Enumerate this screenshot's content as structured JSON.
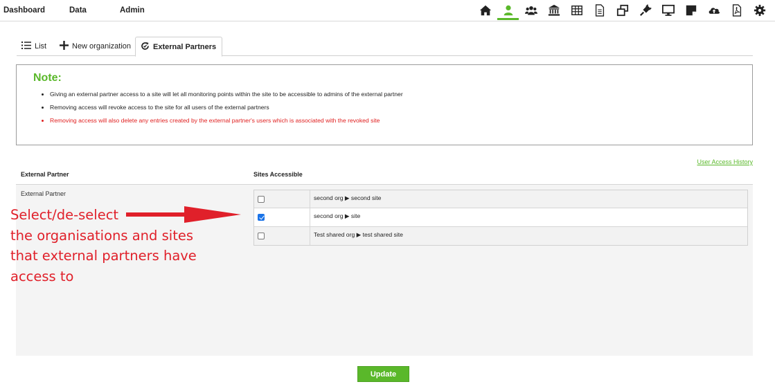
{
  "nav": {
    "menus": [
      "Dashboard",
      "Data",
      "Admin"
    ],
    "icons": [
      "home-icon",
      "user-icon",
      "users-icon",
      "bank-icon",
      "table-icon",
      "document-icon",
      "windows-icon",
      "plug-icon",
      "monitor-icon",
      "note-icon",
      "cloud-upload-icon",
      "pdf-icon",
      "gear-icon"
    ],
    "active_icon": "user-icon"
  },
  "tabs": [
    {
      "label": "List",
      "icon": "list-icon"
    },
    {
      "label": "New organization",
      "icon": "plus-icon"
    },
    {
      "label": "External Partners",
      "icon": "refresh-icon",
      "active": true
    }
  ],
  "note": {
    "title": "Note:",
    "items": [
      "Giving an external partner access to a site will let all monitoring points within the site to be accessible to admins of the external partner",
      "Removing access will revoke access to the site for all users of the external partners",
      "Removing access will also delete any entries created by the external partner's users which is associated with the revoked site"
    ]
  },
  "history_link": "User Access History",
  "table": {
    "headers": [
      "External Partner",
      "Sites Accessible"
    ],
    "partner": "External Partner",
    "sites": [
      {
        "label": "second org ▶ second site",
        "checked": false
      },
      {
        "label": "second org ▶ site",
        "checked": true
      },
      {
        "label": "Test shared org ▶ test shared site",
        "checked": false
      }
    ]
  },
  "annotation": {
    "lines": [
      "Select/de-select",
      "the organisations and sites",
      "that external partners have",
      "access to"
    ]
  },
  "update_button": "Update",
  "colors": {
    "accent": "#5ab82a",
    "warning": "#e02020",
    "annotation": "#e0202a"
  }
}
